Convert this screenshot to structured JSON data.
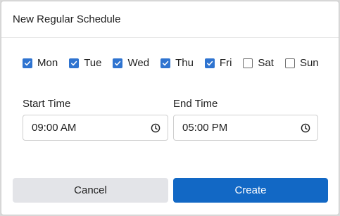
{
  "dialog": {
    "title": "New Regular Schedule"
  },
  "days": [
    {
      "label": "Mon",
      "checked": true
    },
    {
      "label": "Tue",
      "checked": true
    },
    {
      "label": "Wed",
      "checked": true
    },
    {
      "label": "Thu",
      "checked": true
    },
    {
      "label": "Fri",
      "checked": true
    },
    {
      "label": "Sat",
      "checked": false
    },
    {
      "label": "Sun",
      "checked": false
    }
  ],
  "start_time": {
    "label": "Start Time",
    "value": "09:00 AM"
  },
  "end_time": {
    "label": "End Time",
    "value": "05:00 PM"
  },
  "buttons": {
    "cancel_label": "Cancel",
    "create_label": "Create"
  },
  "colors": {
    "accent": "#1268c5",
    "checkbox": "#2f74d0",
    "cancel_bg": "#e3e4e8"
  },
  "icons": {
    "time_picker": "clock-icon",
    "checkbox_mark": "checkmark-icon"
  }
}
